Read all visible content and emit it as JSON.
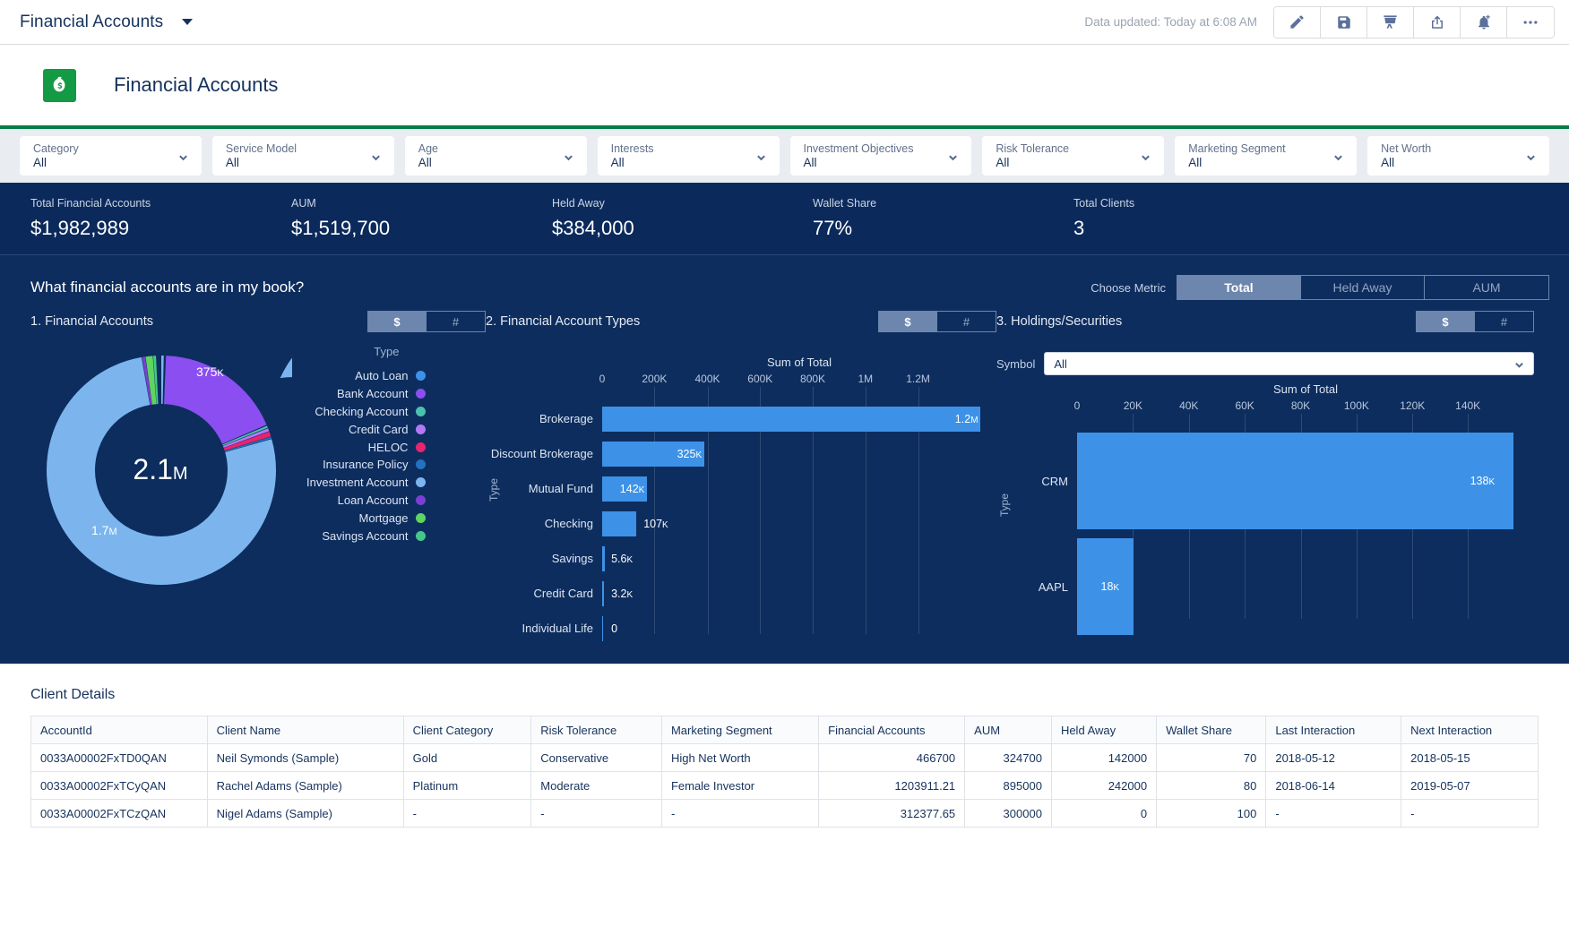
{
  "topbar": {
    "title": "Financial Accounts",
    "updated": "Data updated: Today at 6:08 AM",
    "icons": [
      "edit-pencil-icon",
      "save-disk-icon",
      "presentation-easel-icon",
      "share-icon",
      "subscribe-bell-icon",
      "more-ellipsis-icon"
    ]
  },
  "header": {
    "title": "Financial Accounts",
    "icon": "money-bag-icon",
    "accent": "#027e46"
  },
  "filters": [
    {
      "label": "Category",
      "value": "All"
    },
    {
      "label": "Service Model",
      "value": "All"
    },
    {
      "label": "Age",
      "value": "All"
    },
    {
      "label": "Interests",
      "value": "All"
    },
    {
      "label": "Investment Objectives",
      "value": "All"
    },
    {
      "label": "Risk Tolerance",
      "value": "All"
    },
    {
      "label": "Marketing Segment",
      "value": "All"
    },
    {
      "label": "Net Worth",
      "value": "All"
    }
  ],
  "kpis": [
    {
      "label": "Total Financial Accounts",
      "value": "$1,982,989"
    },
    {
      "label": "AUM",
      "value": "$1,519,700"
    },
    {
      "label": "Held Away",
      "value": "$384,000"
    },
    {
      "label": "Wallet Share",
      "value": "77%"
    },
    {
      "label": "Total Clients",
      "value": "3"
    }
  ],
  "dashboard": {
    "question": "What financial accounts are in my book?",
    "metric_label": "Choose Metric",
    "metric_options": [
      "Total",
      "Held Away",
      "AUM"
    ],
    "metric_selected": "Total",
    "panel1": {
      "title": "1. Financial Accounts",
      "toggle": [
        "$",
        "#"
      ],
      "toggle_selected": "$",
      "legend_header": "Type"
    },
    "panel2": {
      "title": "2. Financial Account Types",
      "toggle": [
        "$",
        "#"
      ],
      "toggle_selected": "$"
    },
    "panel3": {
      "title": "3. Holdings/Securities",
      "toggle": [
        "$",
        "#"
      ],
      "toggle_selected": "$",
      "symbol_label": "Symbol",
      "symbol_value": "All"
    }
  },
  "chart_data": [
    {
      "type": "pie",
      "title": "1. Financial Accounts",
      "center_label": "2.1M",
      "legend_title": "Type",
      "categories": [
        "Auto Loan",
        "Bank Account",
        "Checking Account",
        "Credit Card",
        "HELOC",
        "Insurance Policy",
        "Investment Account",
        "Loan Account",
        "Mortgage",
        "Savings Account"
      ],
      "colors": [
        "#3d92e8",
        "#8b4ef0",
        "#4bc2ad",
        "#b478f5",
        "#e8246f",
        "#2272c0",
        "#7cb5ee",
        "#7b3fd4",
        "#5fd45f",
        "#44c88a"
      ],
      "values": [
        12000,
        375000,
        6000,
        9000,
        14000,
        5000,
        1700000,
        9000,
        21000,
        8000
      ],
      "visible_labels": [
        {
          "text": "375K",
          "for": "Bank Account"
        },
        {
          "text": "1.7M",
          "for": "Investment Account"
        }
      ]
    },
    {
      "type": "bar",
      "orientation": "horizontal",
      "title": "2. Financial Account Types",
      "xlabel": "Sum of Total",
      "ylabel": "Type",
      "categories": [
        "Brokerage",
        "Discount Brokerage",
        "Mutual Fund",
        "Checking",
        "Savings",
        "Credit Card",
        "Individual Life"
      ],
      "values": [
        1200000,
        325000,
        142000,
        107000,
        5600,
        3200,
        0
      ],
      "value_labels": [
        "1.2M",
        "325K",
        "142K",
        "107K",
        "5.6K",
        "3.2K",
        "0"
      ],
      "ticks": [
        "0",
        "200K",
        "400K",
        "600K",
        "800K",
        "1M",
        "1.2M"
      ],
      "tick_values": [
        0,
        200000,
        400000,
        600000,
        800000,
        1000000,
        1200000
      ],
      "xlim": [
        0,
        1250000
      ],
      "bar_color": "#3d92e8"
    },
    {
      "type": "bar",
      "orientation": "horizontal",
      "title": "3. Holdings/Securities",
      "xlabel": "Sum of Total",
      "ylabel": "Type",
      "categories": [
        "CRM",
        "AAPL"
      ],
      "values": [
        138000,
        18000
      ],
      "value_labels": [
        "138K",
        "18K"
      ],
      "ticks": [
        "0",
        "20K",
        "40K",
        "60K",
        "80K",
        "100K",
        "120K",
        "140K"
      ],
      "tick_values": [
        0,
        20000,
        40000,
        60000,
        80000,
        100000,
        120000,
        140000
      ],
      "xlim": [
        0,
        145000
      ],
      "bar_color": "#3d92e8"
    }
  ],
  "table": {
    "title": "Client Details",
    "columns": [
      "AccountId",
      "Client Name",
      "Client Category",
      "Risk Tolerance",
      "Marketing Segment",
      "Financial Accounts",
      "AUM",
      "Held Away",
      "Wallet Share",
      "Last Interaction",
      "Next Interaction"
    ],
    "rows": [
      [
        "0033A00002FxTD0QAN",
        "Neil Symonds (Sample)",
        "Gold",
        "Conservative",
        "High Net Worth",
        "466700",
        "324700",
        "142000",
        "70",
        "2018-05-12",
        "2018-05-15"
      ],
      [
        "0033A00002FxTCyQAN",
        "Rachel Adams (Sample)",
        "Platinum",
        "Moderate",
        "Female Investor",
        "1203911.21",
        "895000",
        "242000",
        "80",
        "2018-06-14",
        "2019-05-07"
      ],
      [
        "0033A00002FxTCzQAN",
        "Nigel Adams (Sample)",
        "-",
        "-",
        "-",
        "312377.65",
        "300000",
        "0",
        "100",
        "-",
        "-"
      ]
    ]
  }
}
